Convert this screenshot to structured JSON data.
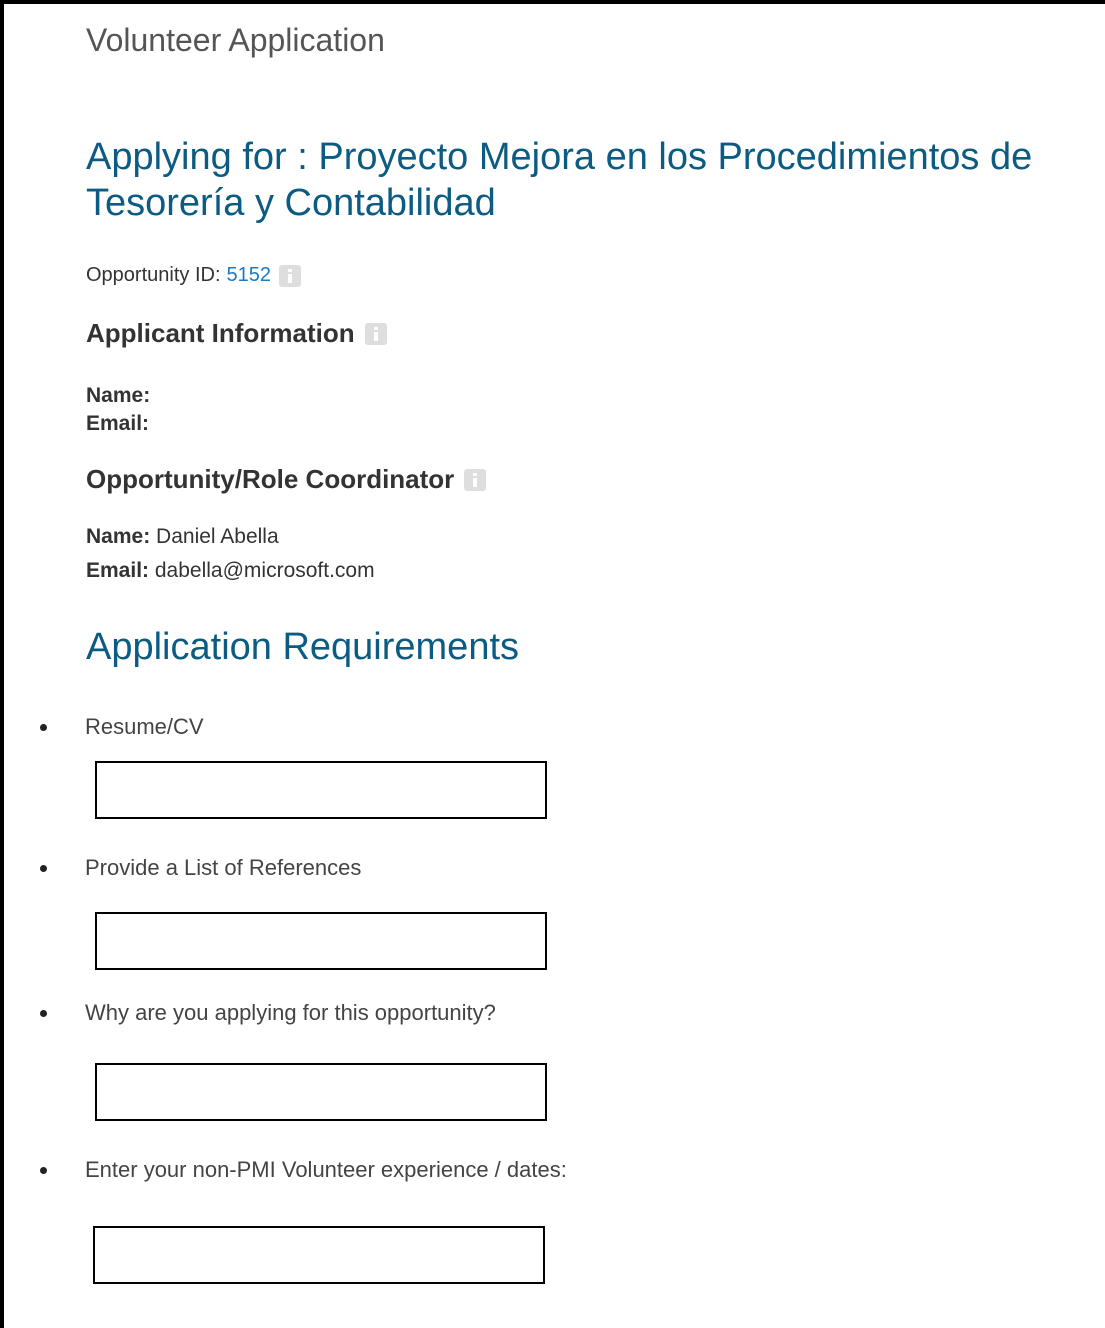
{
  "page": {
    "header": "Volunteer Application",
    "applying_for": "Applying for : Proyecto Mejora en los Procedimientos de Tesorería y Contabilidad"
  },
  "opportunity": {
    "id_label": "Opportunity ID:",
    "id_value": "5152"
  },
  "applicant": {
    "heading": "Applicant Information",
    "name_label": "Name:",
    "name_value": "",
    "email_label": "Email:",
    "email_value": ""
  },
  "coordinator": {
    "heading": "Opportunity/Role Coordinator",
    "name_label": "Name:",
    "name_value": "Daniel Abella",
    "email_label": "Email:",
    "email_value": "dabella@microsoft.com"
  },
  "requirements": {
    "heading": "Application Requirements",
    "items": [
      {
        "label": "Resume/CV",
        "value": ""
      },
      {
        "label": "Provide a List of References",
        "value": ""
      },
      {
        "label": "Why are you applying for this opportunity?",
        "value": ""
      },
      {
        "label": "Enter your non-PMI Volunteer experience / dates:",
        "value": ""
      }
    ]
  },
  "icons": {
    "info": "info-icon"
  },
  "colors": {
    "heading_blue": "#0b5b82",
    "link_blue": "#1a7ac2",
    "text": "#333333"
  }
}
